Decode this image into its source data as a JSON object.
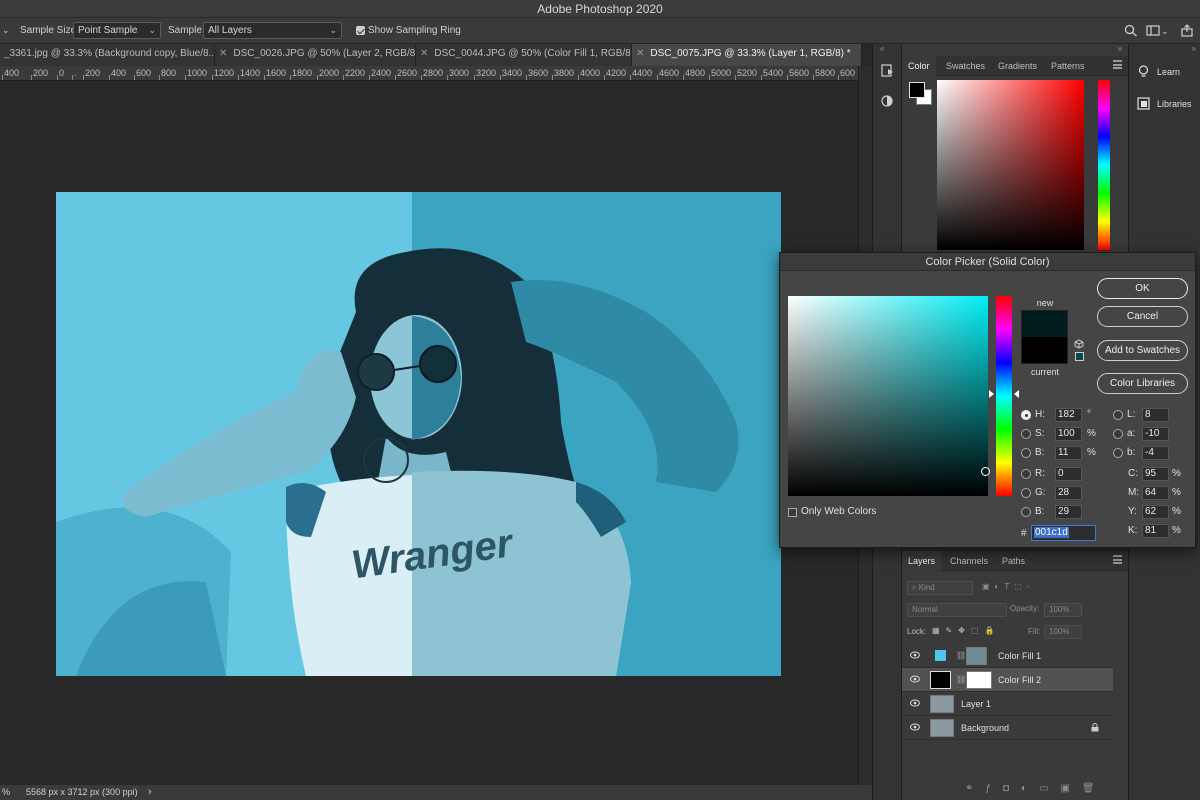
{
  "app": {
    "title": "Adobe Photoshop 2020"
  },
  "options_bar": {
    "sample_size_label": "Sample Size:",
    "sample_size_value": "Point Sample",
    "sample_label": "Sample:",
    "sample_value": "All Layers",
    "show_ring_label": "Show Sampling Ring",
    "show_ring_checked": true
  },
  "doc_tabs": [
    {
      "label": "_3361.jpg @ 33.3% (Background copy, Blue/8...",
      "active": false
    },
    {
      "label": "DSC_0026.JPG @ 50% (Layer 2, RGB/8*)...",
      "active": false
    },
    {
      "label": "DSC_0044.JPG @ 50% (Color Fill 1, RGB/8*...",
      "active": false
    },
    {
      "label": "DSC_0075.JPG @ 33.3% (Layer 1, RGB/8) *",
      "active": true
    }
  ],
  "ruler_labels": [
    "400",
    "200",
    "0",
    ".",
    "200",
    "400",
    "600",
    "800",
    "1000",
    "1200",
    "1400",
    "1600",
    "1800",
    "2000",
    "2200",
    "2400",
    "2600",
    "2800",
    "3000",
    "3200",
    "3400",
    "3600",
    "3800",
    "4000",
    "4200",
    "4400",
    "4600",
    "4800",
    "5000",
    "5200",
    "5400",
    "5600",
    "5800",
    "600"
  ],
  "status_bar": {
    "zoom": "%",
    "doc_info": "5568 px x 3712 px (300 ppi)",
    "arrow": "›"
  },
  "color_panel": {
    "tabs": [
      "Color",
      "Swatches",
      "Gradients",
      "Patterns"
    ],
    "active_tab": "Color",
    "foreground": "#000000",
    "background": "#ffffff"
  },
  "learn_column": {
    "learn_label": "Learn",
    "libraries_label": "Libraries"
  },
  "color_picker": {
    "title": "Color Picker (Solid Color)",
    "new_label": "new",
    "current_label": "current",
    "new_color": "#001c1d",
    "current_color": "#000000",
    "buttons": {
      "ok": "OK",
      "cancel": "Cancel",
      "add_to_swatches": "Add to Swatches",
      "color_libraries": "Color Libraries"
    },
    "hsb": {
      "h": "182",
      "s": "100",
      "b": "11",
      "h_unit": "°",
      "s_unit": "%",
      "b_unit": "%",
      "selected": "H"
    },
    "rgb": {
      "r": "0",
      "g": "28",
      "b": "29"
    },
    "lab": {
      "l": "8",
      "a": "-10",
      "b": "-4"
    },
    "cmyk": {
      "c": "95",
      "m": "64",
      "y": "62",
      "k": "81",
      "unit": "%"
    },
    "only_web_colors_label": "Only Web Colors",
    "only_web_colors_checked": false,
    "hex": "001c1d"
  },
  "layers_panel": {
    "tabs": [
      "Layers",
      "Channels",
      "Paths"
    ],
    "active_tab": "Layers",
    "filter_label": "Kind",
    "blend_mode": "Normal",
    "opacity_label": "Opacity:",
    "opacity_value": "100%",
    "lock_label": "Lock:",
    "fill_label": "Fill:",
    "fill_value": "100%",
    "layers": [
      {
        "name": "Color Fill 1",
        "type": "fill",
        "swatch": "#4ec6ea",
        "selected": false,
        "locked": false
      },
      {
        "name": "Color Fill 2",
        "type": "fill",
        "swatch": "#000000",
        "selected": true,
        "locked": false
      },
      {
        "name": "Layer 1",
        "type": "pixel",
        "selected": false,
        "locked": false
      },
      {
        "name": "Background",
        "type": "pixel",
        "selected": false,
        "locked": true
      }
    ]
  },
  "canvas_text": {
    "shirt_text": "Wranger"
  }
}
